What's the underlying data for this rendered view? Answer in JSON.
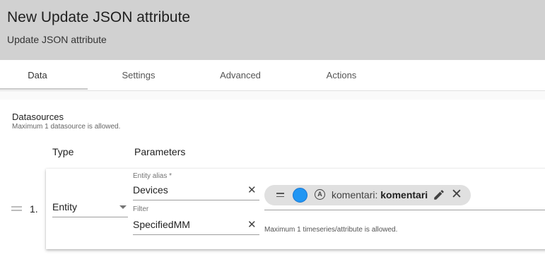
{
  "header": {
    "title": "New Update JSON attribute",
    "subtitle": "Update JSON attribute"
  },
  "tabs": [
    {
      "label": "Data",
      "active": true
    },
    {
      "label": "Settings",
      "active": false
    },
    {
      "label": "Advanced",
      "active": false
    },
    {
      "label": "Actions",
      "active": false
    }
  ],
  "datasources": {
    "title": "Datasources",
    "hint": "Maximum 1 datasource is allowed.",
    "columns": {
      "type": "Type",
      "parameters": "Parameters"
    },
    "rows": [
      {
        "index": "1.",
        "type": "Entity",
        "entity_alias": {
          "label": "Entity alias *",
          "value": "Devices"
        },
        "filter": {
          "label": "Filter",
          "value": "SpecifiedMM"
        },
        "key_chip": {
          "prefix": "komentari: ",
          "label": "komentari",
          "color": "#2196f3",
          "type_icon": "attribute-icon"
        },
        "keys_hint": "Maximum 1 timeseries/attribute is allowed."
      }
    ]
  },
  "icons": {
    "drag": "drag-handle-icon",
    "clear": "close-icon",
    "edit": "pencil-icon",
    "remove": "close-icon",
    "dropdown": "arrow-drop-down-icon"
  },
  "colors": {
    "header_bg": "#d1d1d1",
    "chip_bg": "#e0e0e0",
    "chip_color": "#2196f3"
  }
}
